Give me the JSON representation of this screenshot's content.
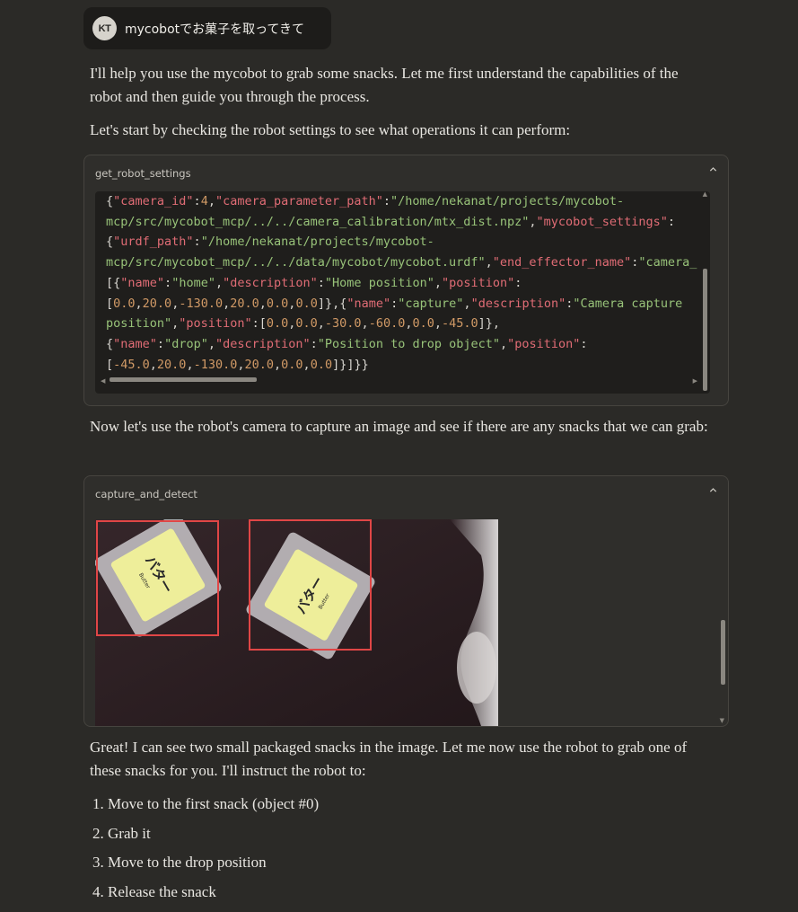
{
  "user_message": {
    "avatar_initials": "KT",
    "text": "mycobotでお菓子を取ってきて"
  },
  "paragraphs": {
    "intro": "I'll help you use the mycobot to grab some snacks. Let me first understand the capabilities of the robot and then guide you through the process.",
    "check_settings": "Let's start by checking the robot settings to see what operations it can perform:",
    "capture": "Now let's use the robot's camera to capture an image and see if there are any snacks that we can grab:",
    "great": "Great! I can see two small packaged snacks in the image. Let me now use the robot to grab one of these snacks for you. I'll instruct the robot to:"
  },
  "tool_settings": {
    "name": "get_robot_settings",
    "collapse_icon": "chevron-up-icon",
    "code_lines": [
      [
        [
          "p",
          "{"
        ],
        [
          "k",
          "\"camera_id\""
        ],
        [
          "p",
          ":"
        ],
        [
          "n",
          "4"
        ],
        [
          "p",
          ","
        ],
        [
          "k",
          "\"camera_parameter_path\""
        ],
        [
          "p",
          ":"
        ],
        [
          "s",
          "\"/home/nekanat/projects/mycobot-"
        ]
      ],
      [
        [
          "s",
          "mcp/src/mycobot_mcp/../../camera_calibration/mtx_dist.npz\""
        ],
        [
          "p",
          ","
        ],
        [
          "k",
          "\"mycobot_settings\""
        ],
        [
          "p",
          ":"
        ]
      ],
      [
        [
          "p",
          "{"
        ],
        [
          "k",
          "\"urdf_path\""
        ],
        [
          "p",
          ":"
        ],
        [
          "s",
          "\"/home/nekanat/projects/mycobot-"
        ]
      ],
      [
        [
          "s",
          "mcp/src/mycobot_mcp/../../data/mycobot/mycobot.urdf\""
        ],
        [
          "p",
          ","
        ],
        [
          "k",
          "\"end_effector_name\""
        ],
        [
          "p",
          ":"
        ],
        [
          "s",
          "\"camera_"
        ]
      ],
      [
        [
          "p",
          "[{"
        ],
        [
          "k",
          "\"name\""
        ],
        [
          "p",
          ":"
        ],
        [
          "s",
          "\"home\""
        ],
        [
          "p",
          ","
        ],
        [
          "k",
          "\"description\""
        ],
        [
          "p",
          ":"
        ],
        [
          "s",
          "\"Home position\""
        ],
        [
          "p",
          ","
        ],
        [
          "k",
          "\"position\""
        ],
        [
          "p",
          ":"
        ]
      ],
      [
        [
          "p",
          "["
        ],
        [
          "n",
          "0.0"
        ],
        [
          "p",
          ","
        ],
        [
          "n",
          "20.0"
        ],
        [
          "p",
          ","
        ],
        [
          "n",
          "-130.0"
        ],
        [
          "p",
          ","
        ],
        [
          "n",
          "20.0"
        ],
        [
          "p",
          ","
        ],
        [
          "n",
          "0.0"
        ],
        [
          "p",
          ","
        ],
        [
          "n",
          "0.0"
        ],
        [
          "p",
          "]},{"
        ],
        [
          "k",
          "\"name\""
        ],
        [
          "p",
          ":"
        ],
        [
          "s",
          "\"capture\""
        ],
        [
          "p",
          ","
        ],
        [
          "k",
          "\"description\""
        ],
        [
          "p",
          ":"
        ],
        [
          "s",
          "\"Camera capture"
        ]
      ],
      [
        [
          "s",
          "position\""
        ],
        [
          "p",
          ","
        ],
        [
          "k",
          "\"position\""
        ],
        [
          "p",
          ":["
        ],
        [
          "n",
          "0.0"
        ],
        [
          "p",
          ","
        ],
        [
          "n",
          "0.0"
        ],
        [
          "p",
          ","
        ],
        [
          "n",
          "-30.0"
        ],
        [
          "p",
          ","
        ],
        [
          "n",
          "-60.0"
        ],
        [
          "p",
          ","
        ],
        [
          "n",
          "0.0"
        ],
        [
          "p",
          ","
        ],
        [
          "n",
          "-45.0"
        ],
        [
          "p",
          "]},"
        ]
      ],
      [
        [
          "p",
          "{"
        ],
        [
          "k",
          "\"name\""
        ],
        [
          "p",
          ":"
        ],
        [
          "s",
          "\"drop\""
        ],
        [
          "p",
          ","
        ],
        [
          "k",
          "\"description\""
        ],
        [
          "p",
          ":"
        ],
        [
          "s",
          "\"Position to drop object\""
        ],
        [
          "p",
          ","
        ],
        [
          "k",
          "\"position\""
        ],
        [
          "p",
          ":"
        ]
      ],
      [
        [
          "p",
          "["
        ],
        [
          "n",
          "-45.0"
        ],
        [
          "p",
          ","
        ],
        [
          "n",
          "20.0"
        ],
        [
          "p",
          ","
        ],
        [
          "n",
          "-130.0"
        ],
        [
          "p",
          ","
        ],
        [
          "n",
          "20.0"
        ],
        [
          "p",
          ","
        ],
        [
          "n",
          "0.0"
        ],
        [
          "p",
          ","
        ],
        [
          "n",
          "0.0"
        ],
        [
          "p",
          "]}]}}"
        ]
      ]
    ]
  },
  "tool_capture": {
    "name": "capture_and_detect",
    "collapse_icon": "chevron-up-icon",
    "image": {
      "description_icon": "camera-snapshot-image",
      "snack_label": "バター",
      "snack_sub_label": "Butter",
      "box_color": "#e04646"
    }
  },
  "steps": [
    "Move to the first snack (object #0)",
    "Grab it",
    "Move to the drop position",
    "Release the snack"
  ],
  "colors": {
    "background": "#2b2a27",
    "code_background": "#1f1e1c",
    "key": "#e06c75",
    "string": "#98c379",
    "number": "#d19a66"
  }
}
